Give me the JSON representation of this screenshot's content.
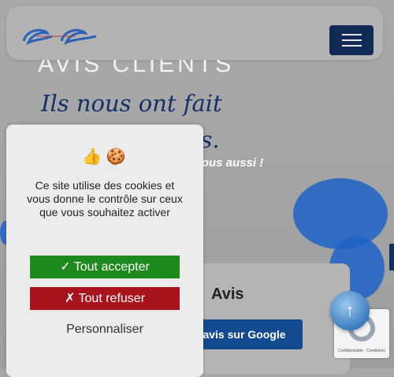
{
  "header": {
    "logo_icon": "brand-logo",
    "menu_icon": "hamburger-icon"
  },
  "hero": {
    "title": "AVIS CLIENTS",
    "tagline": "Ils nous ont fait confiance, avis.",
    "subtitle": "tience vous aussi !"
  },
  "reviews": {
    "google_mark": "e",
    "avis_label": "Avis",
    "google_button": "avis sur Google"
  },
  "cookie_banner": {
    "emoji": "👍 🍪",
    "message": "Ce site utilise des cookies et vous donne le contrôle sur ceux que vous souhaitez activer",
    "accept_label": "✓ Tout accepter",
    "refuse_label": "✗ Tout refuser",
    "customize_label": "Personnaliser",
    "accept_color": "#1c8a1c",
    "refuse_color": "#a8141b"
  },
  "recaptcha": {
    "footer": "Confidentialité - Conditions"
  },
  "scroll_top": {
    "icon": "↑"
  },
  "colors": {
    "navy": "#0e2a55",
    "splash_blue": "#1f63c8"
  }
}
